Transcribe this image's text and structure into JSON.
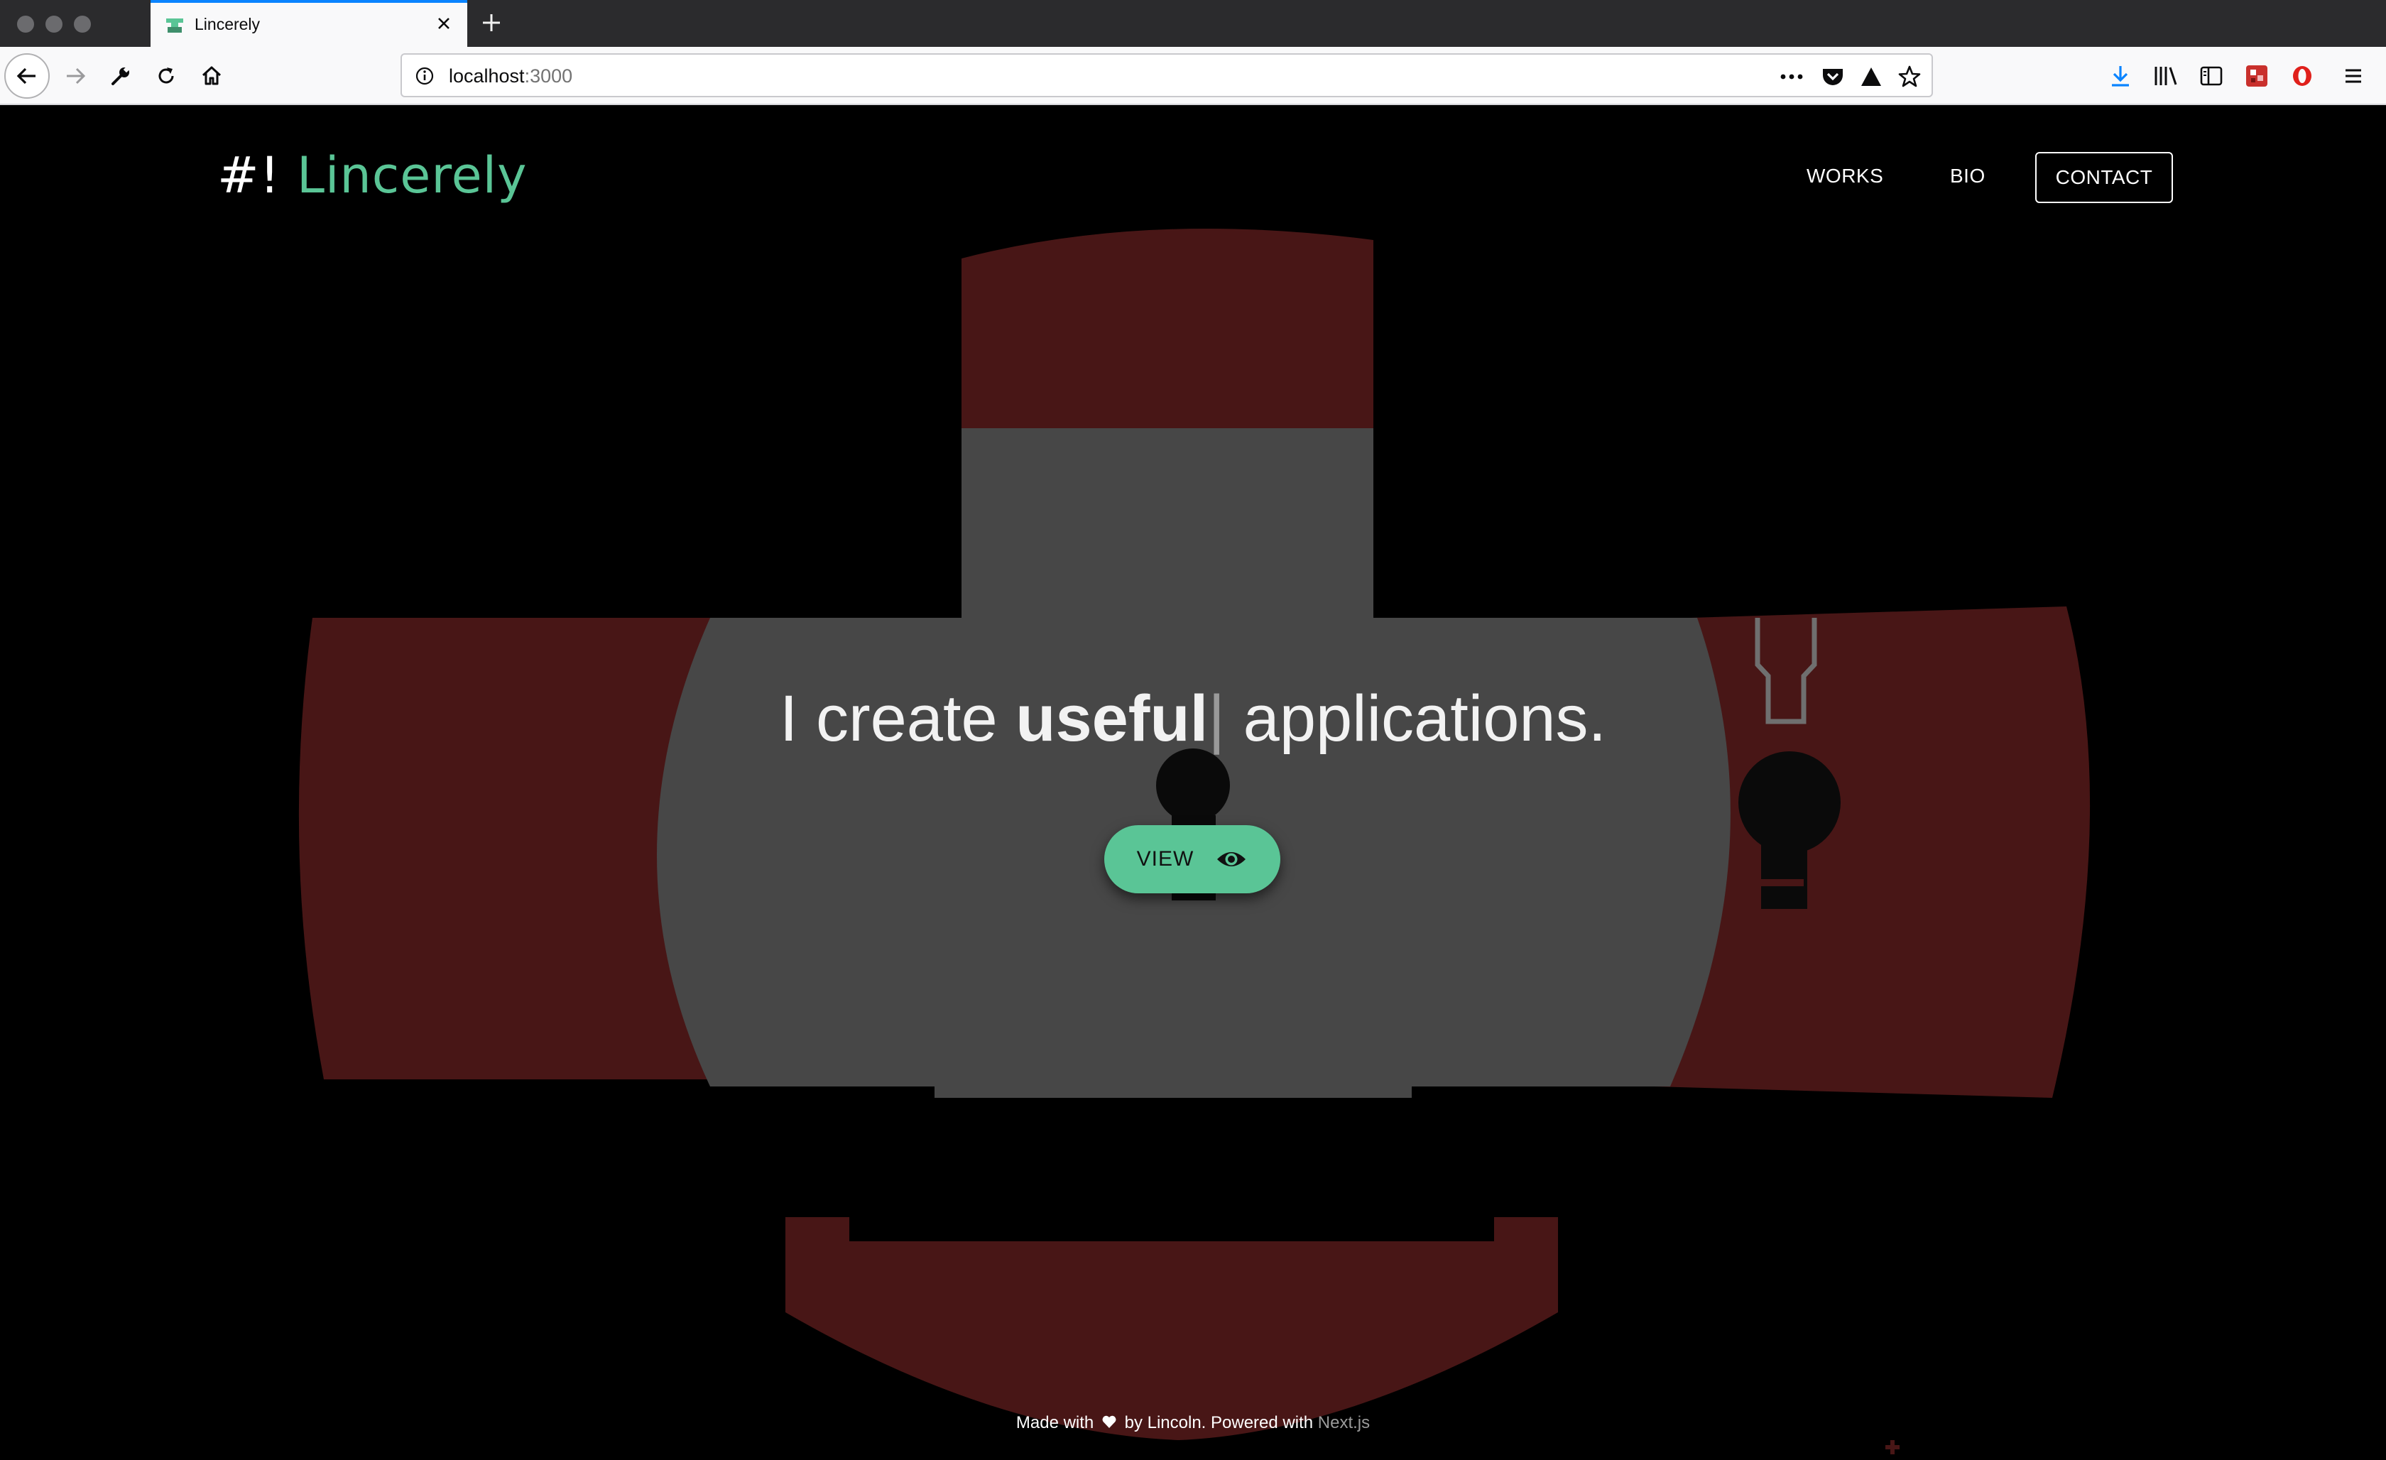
{
  "browser": {
    "tab_title": "Lincerely",
    "url_host": "localhost",
    "url_port": ":3000",
    "icons": [
      "back-icon",
      "forward-icon",
      "wrench-icon",
      "reload-icon",
      "home-icon",
      "info-icon",
      "more-icon",
      "pocket-icon",
      "triangle-icon",
      "bookmark-star-icon",
      "download-icon",
      "library-icon",
      "sidebar-icon",
      "extension-icon",
      "opera-icon",
      "menu-icon",
      "close-icon",
      "new-tab-icon"
    ]
  },
  "nav": {
    "brand_prefix": "#!",
    "brand_name": "Lincerely",
    "links": [
      "WORKS",
      "BIO"
    ],
    "contact": "CONTACT"
  },
  "hero": {
    "text_before": "I create ",
    "text_strong": "useful",
    "text_cursor": "|",
    "text_after": " applications.",
    "button_label": "VIEW",
    "button_icon": "eye-icon"
  },
  "footer": {
    "made_with": "Made with",
    "by": "by Lincoln. Powered with",
    "link": "Next.js"
  },
  "colors": {
    "accent": "#5ac596",
    "dark_red": "#481616",
    "gray": "#474747",
    "background": "#000000"
  }
}
